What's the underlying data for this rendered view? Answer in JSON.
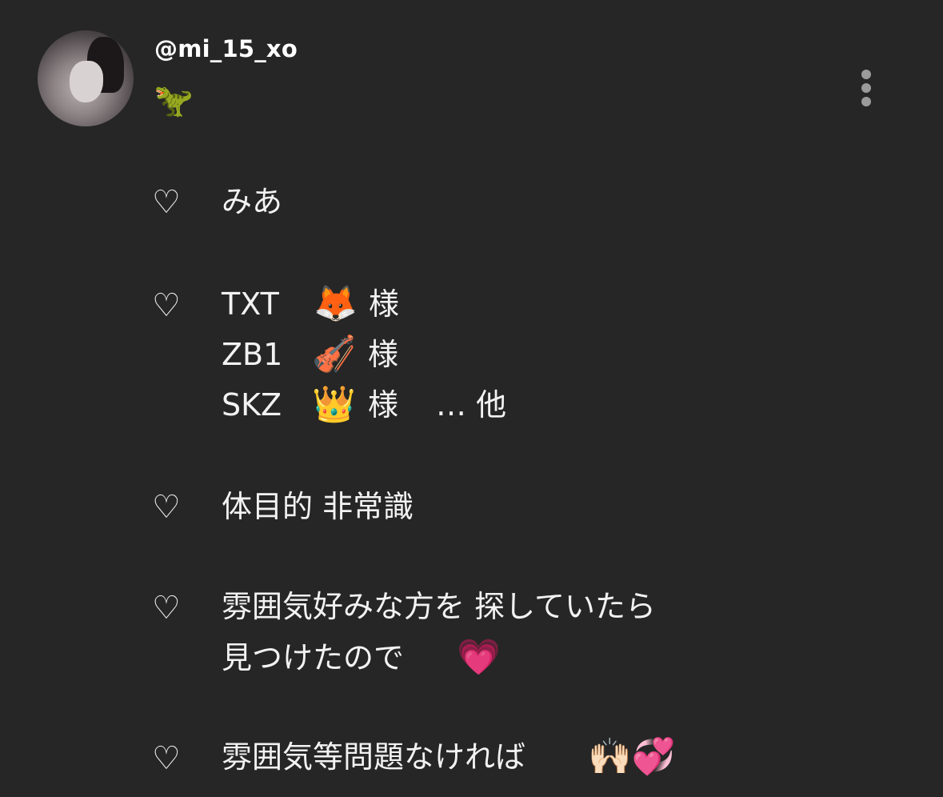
{
  "profile": {
    "username": "@mi_15_xo",
    "bio_emoji": "🦖"
  },
  "bio": {
    "heart_symbol": "♡",
    "name": "みあ",
    "fandoms": [
      {
        "group": "TXT",
        "emoji": "🦊",
        "suffix": "様"
      },
      {
        "group": "ZB1",
        "emoji": "🎻",
        "suffix": "様"
      },
      {
        "group": "SKZ",
        "emoji": "👑",
        "suffix": "様",
        "extra": "… 他"
      }
    ],
    "purpose": "体目的 非常識",
    "reason_line1": "雰囲気好みな方を 探していたら",
    "reason_line2": "見つけたので",
    "reason_emoji": "💗",
    "condition": "雰囲気等問題なければ",
    "condition_emoji": "🙌🏻💞"
  },
  "colors": {
    "background": "#262626",
    "text": "#f2f2f2",
    "menu_dots": "#9b9b9b"
  },
  "icons": {
    "more": "vertical-ellipsis-icon",
    "heart": "outline-heart-icon"
  }
}
